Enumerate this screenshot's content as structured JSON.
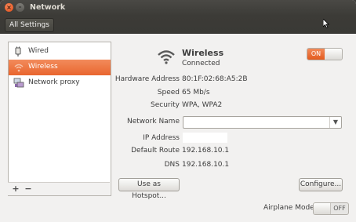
{
  "window": {
    "title": "Network"
  },
  "toolbar": {
    "all_settings": "All Settings"
  },
  "sidebar": {
    "items": [
      {
        "label": "Wired",
        "icon": "wired-plug-icon"
      },
      {
        "label": "Wireless",
        "icon": "wifi-icon",
        "selected": true
      },
      {
        "label": "Network proxy",
        "icon": "network-proxy-icon"
      }
    ],
    "add": "+",
    "remove": "−"
  },
  "device": {
    "title": "Wireless",
    "status": "Connected",
    "toggle": "ON",
    "fields": [
      {
        "label": "Hardware Address",
        "value": "80:1F:02:68:A5:2B"
      },
      {
        "label": "Speed",
        "value": "65 Mb/s"
      },
      {
        "label": "Security",
        "value": "WPA, WPA2"
      },
      {
        "label": "Network Name",
        "value": ""
      },
      {
        "label": "IP Address",
        "value": ""
      },
      {
        "label": "Default Route",
        "value": "192.168.10.1"
      },
      {
        "label": "DNS",
        "value": "192.168.10.1"
      }
    ],
    "hotspot_button": "Use as Hotspot...",
    "configure_button": "Configure..."
  },
  "airplane": {
    "label": "Airplane Mode",
    "toggle": "OFF"
  },
  "colors": {
    "accent": "#e9662f",
    "titlebar": "#3c3b37"
  }
}
